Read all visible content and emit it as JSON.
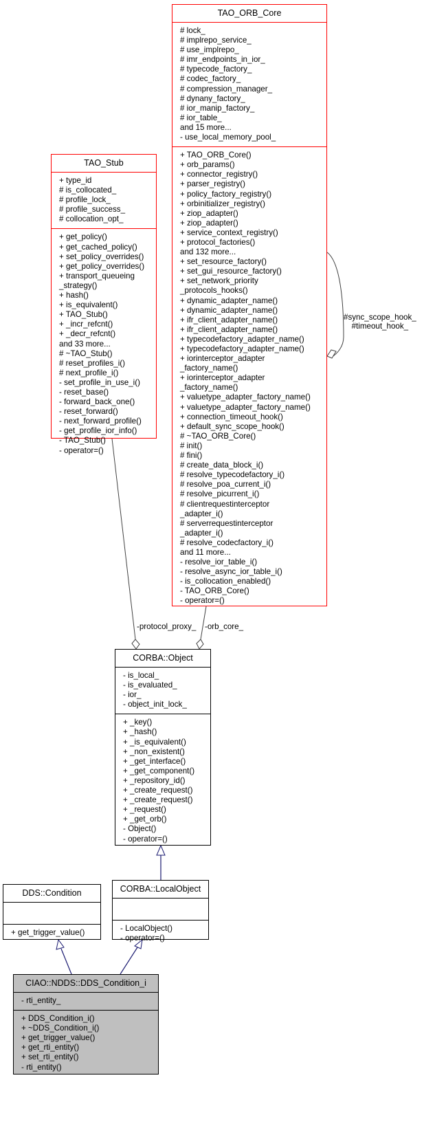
{
  "classes": {
    "tao_orb_core": {
      "name": "TAO_ORB_Core",
      "attributes": [
        "# lock_",
        "# implrepo_service_",
        "# use_implrepo_",
        "# imr_endpoints_in_ior_",
        "# typecode_factory_",
        "# codec_factory_",
        "# compression_manager_",
        "# dynany_factory_",
        "# ior_manip_factory_",
        "# ior_table_",
        "and 15 more...",
        "- use_local_memory_pool_"
      ],
      "methods": [
        "+ TAO_ORB_Core()",
        "+ orb_params()",
        "+ connector_registry()",
        "+ parser_registry()",
        "+ policy_factory_registry()",
        "+ orbinitializer_registry()",
        "+ ziop_adapter()",
        "+ ziop_adapter()",
        "+ service_context_registry()",
        "+ protocol_factories()",
        "and 132 more...",
        "+ set_resource_factory()",
        "+ set_gui_resource_factory()",
        "+ set_network_priority",
        "_protocols_hooks()",
        "+ dynamic_adapter_name()",
        "+ dynamic_adapter_name()",
        "+ ifr_client_adapter_name()",
        "+ ifr_client_adapter_name()",
        "+ typecodefactory_adapter_name()",
        "+ typecodefactory_adapter_name()",
        "+ iorinterceptor_adapter",
        "_factory_name()",
        "+ iorinterceptor_adapter",
        "_factory_name()",
        "+ valuetype_adapter_factory_name()",
        "+ valuetype_adapter_factory_name()",
        "+ connection_timeout_hook()",
        "+ default_sync_scope_hook()",
        "# ~TAO_ORB_Core()",
        "# init()",
        "# fini()",
        "# create_data_block_i()",
        "# resolve_typecodefactory_i()",
        "# resolve_poa_current_i()",
        "# resolve_picurrent_i()",
        "# clientrequestinterceptor",
        "_adapter_i()",
        "# serverrequestinterceptor",
        "_adapter_i()",
        "# resolve_codecfactory_i()",
        "and 11 more...",
        "- resolve_ior_table_i()",
        "- resolve_async_ior_table_i()",
        "- is_collocation_enabled()",
        "- TAO_ORB_Core()",
        "- operator=()"
      ]
    },
    "tao_stub": {
      "name": "TAO_Stub",
      "attributes": [
        "+ type_id",
        "# is_collocated_",
        "# profile_lock_",
        "# profile_success_",
        "# collocation_opt_"
      ],
      "methods": [
        "+ get_policy()",
        "+ get_cached_policy()",
        "+ set_policy_overrides()",
        "+ get_policy_overrides()",
        "+ transport_queueing",
        "_strategy()",
        "+ hash()",
        "+ is_equivalent()",
        "+ TAO_Stub()",
        "+ _incr_refcnt()",
        "+ _decr_refcnt()",
        "and 33 more...",
        "# ~TAO_Stub()",
        "# reset_profiles_i()",
        "# next_profile_i()",
        "- set_profile_in_use_i()",
        "- reset_base()",
        "- forward_back_one()",
        "- reset_forward()",
        "- next_forward_profile()",
        "- get_profile_ior_info()",
        "- TAO_Stub()",
        "- operator=()"
      ]
    },
    "corba_object": {
      "name": "CORBA::Object",
      "attributes": [
        "- is_local_",
        "- is_evaluated_",
        "- ior_",
        "- object_init_lock_"
      ],
      "methods": [
        "+ _key()",
        "+ _hash()",
        "+ _is_equivalent()",
        "+ _non_existent()",
        "+ _get_interface()",
        "+ _get_component()",
        "+ _repository_id()",
        "+ _create_request()",
        "+ _create_request()",
        "+ _request()",
        "+ _get_orb()",
        "- Object()",
        "- operator=()"
      ]
    },
    "dds_condition": {
      "name": "DDS::Condition",
      "attributes": [],
      "methods": [
        "+ get_trigger_value()"
      ]
    },
    "corba_localobject": {
      "name": "CORBA::LocalObject",
      "attributes": [],
      "methods": [
        "- LocalObject()",
        "- operator=()"
      ]
    },
    "dds_condition_i": {
      "name": "CIAO::NDDS::DDS_Condition_i",
      "attributes": [
        "- rti_entity_"
      ],
      "methods": [
        "+ DDS_Condition_i()",
        "+ ~DDS_Condition_i()",
        "+ get_trigger_value()",
        "+ get_rti_entity()",
        "+ set_rti_entity()",
        "- rti_entity()"
      ]
    }
  },
  "edge_labels": {
    "self_assoc": [
      "#sync_scope_hook_",
      "#timeout_hook_"
    ],
    "protocol_proxy": "-protocol_proxy_",
    "orb_core": "-orb_core_"
  },
  "colors": {
    "class_border_default": "#000000",
    "class_border_incomplete": "#ff0000",
    "focus_class_fill": "#bfbfbf",
    "inheritance_edge": "#191970",
    "association_edge": "#404040"
  }
}
